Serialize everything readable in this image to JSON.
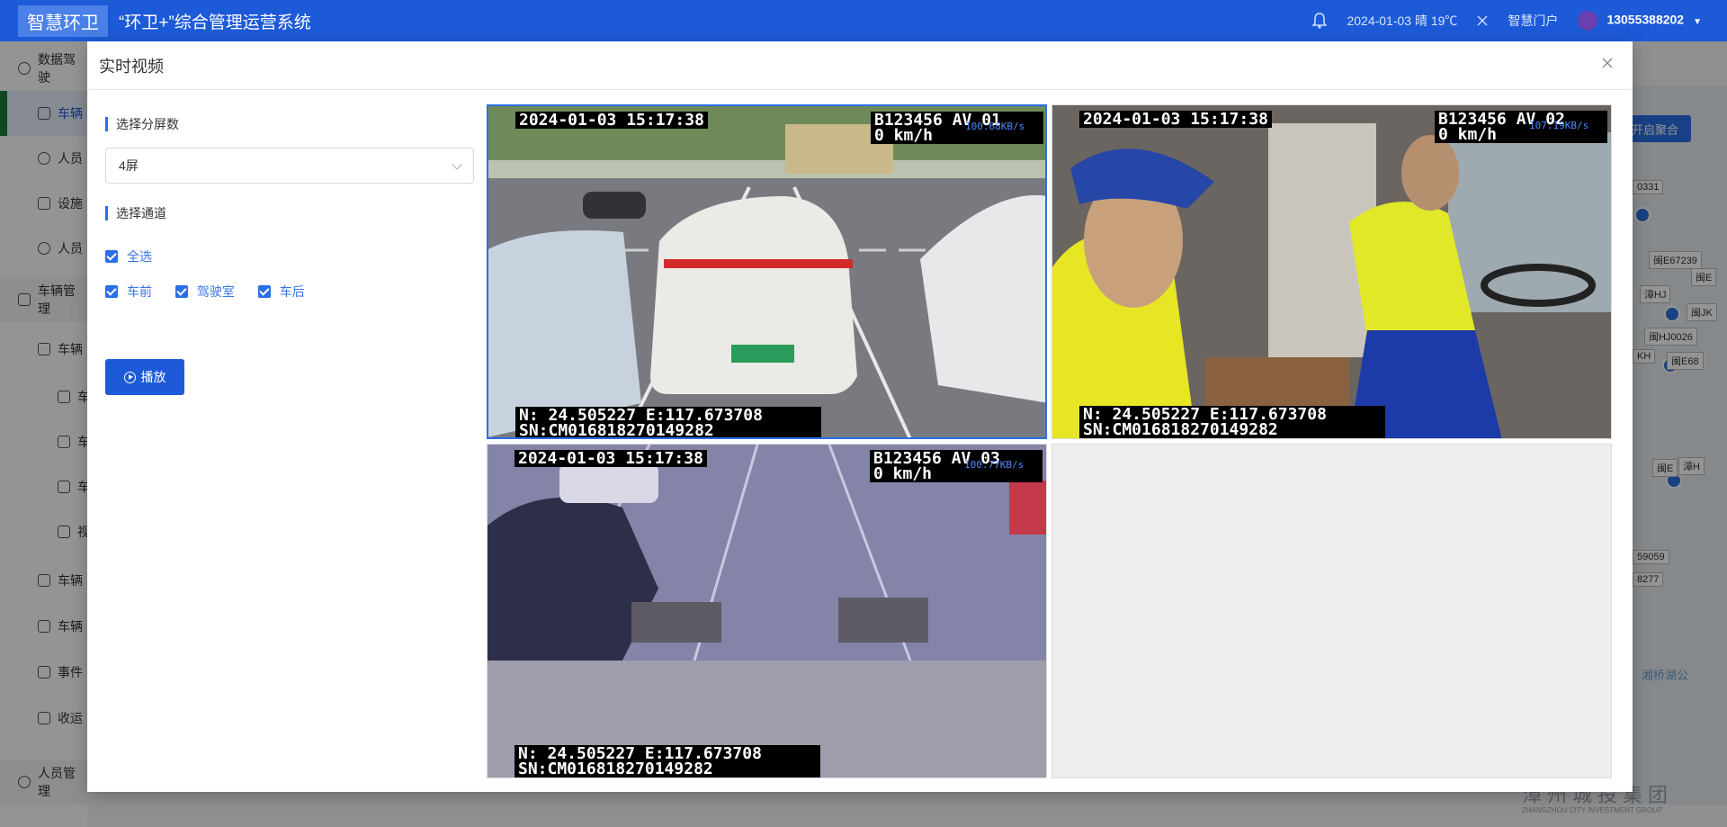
{
  "header": {
    "logo": "智慧环卫",
    "title": "“环卫+”综合管理运营系统",
    "datetime_weather": "2024-01-03 晴 19℃",
    "portal_link": "智慧门户",
    "user_phone": "13055388202"
  },
  "sidebar": {
    "items": [
      {
        "label": "数据驾驶"
      },
      {
        "label": "车辆"
      },
      {
        "label": "人员"
      },
      {
        "label": "设施"
      },
      {
        "label": "人员"
      },
      {
        "label": "车辆管理"
      },
      {
        "label": "车辆"
      },
      {
        "label": "车"
      },
      {
        "label": "车"
      },
      {
        "label": "车"
      },
      {
        "label": "视"
      },
      {
        "label": "车辆"
      },
      {
        "label": "车辆"
      },
      {
        "label": "事件"
      },
      {
        "label": "收运"
      },
      {
        "label": "人员管理"
      }
    ]
  },
  "map": {
    "cluster_button": "开启聚合",
    "labels": [
      "0331",
      "闽E67239",
      "闽E",
      "漳HJ",
      "闽JK",
      "闽HJ0026",
      "KH",
      "闽E68",
      "闽E",
      "漳H",
      "59059",
      "8277",
      "湘桥湖公"
    ],
    "watermark": "漳州城投集团",
    "watermark_en": "ZHANGZHOU CITY INVESTMENT GROUP"
  },
  "modal": {
    "title": "实时视频",
    "close_icon": "close-icon",
    "split_label": "选择分屏数",
    "split_value": "4屏",
    "channel_label": "选择通道",
    "select_all": "全选",
    "channels": [
      "车前",
      "驾驶室",
      "车后"
    ],
    "play_button": "播放"
  },
  "videos": [
    {
      "time": "2024-01-03 15:17:38",
      "plate_channel": "B123456 AV 01",
      "speed": "0 km/h",
      "rate": "100.68KB/s",
      "gps": "N: 24.505227 E:117.673708",
      "sn": "SN:CM016818270149282",
      "selected": true
    },
    {
      "time": "2024-01-03 15:17:38",
      "plate_channel": "B123456 AV 02",
      "speed": "0 km/h",
      "rate": "107.19KB/s",
      "gps": "N: 24.505227 E:117.673708",
      "sn": "SN:CM016818270149282",
      "selected": false
    },
    {
      "time": "2024-01-03 15:17:38",
      "plate_channel": "B123456 AV 03",
      "speed": "0 km/h",
      "rate": "100.77KB/s",
      "gps": "N: 24.505227 E:117.673708",
      "sn": "SN:CM016818270149282",
      "selected": false
    }
  ],
  "colors": {
    "primary": "#1d5ad8",
    "accent": "#2a6fe6"
  }
}
